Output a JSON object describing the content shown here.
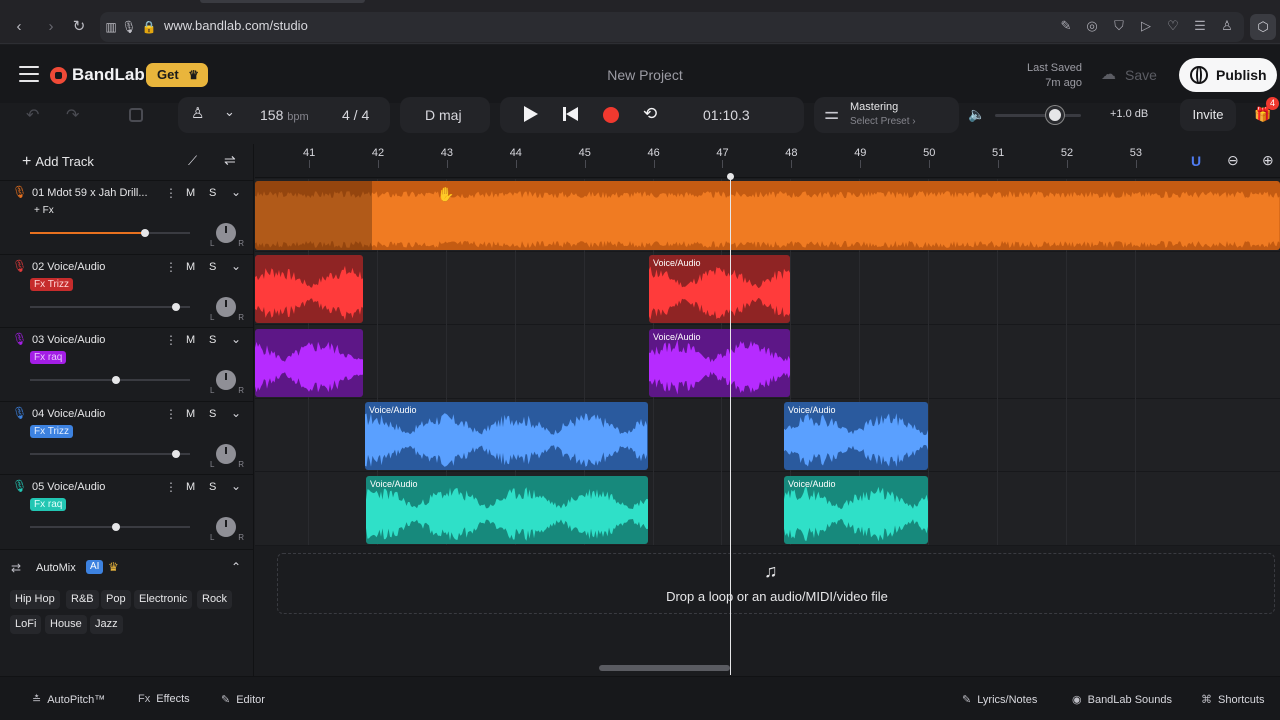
{
  "browser": {
    "url": "www.bandlab.com/studio"
  },
  "header": {
    "logo_text": "BandLab",
    "get_label": "Get",
    "project_title": "New Project",
    "last_saved_line1": "Last Saved",
    "last_saved_line2": "7m ago",
    "save_label": "Save",
    "publish_label": "Publish"
  },
  "transport": {
    "bpm_value": "158",
    "bpm_unit": "bpm",
    "time_signature": "4 / 4",
    "key": "D maj",
    "time": "01:10.3",
    "mastering_title": "Mastering",
    "mastering_sub": "Select Preset ›",
    "volume_db": "+1.0 dB",
    "volume_level": 0.7,
    "invite_label": "Invite",
    "gift_badge": "4"
  },
  "left_panel": {
    "add_track_label": "Add Track",
    "tracks": [
      {
        "number": "01",
        "name": "Mdot 59 x Jah Drill...",
        "fx": "+ Fx",
        "color": "#e8711f",
        "fx_bg": "transparent",
        "fx_color": "#e6e6e8",
        "volume": 0.72
      },
      {
        "number": "02",
        "name": "Voice/Audio",
        "fx": "Fx Trizz",
        "color": "#e23a3a",
        "fx_bg": "#c62c2c",
        "fx_color": "#ffd9d9",
        "volume": 0.91
      },
      {
        "number": "03",
        "name": "Voice/Audio",
        "fx": "Fx raq",
        "color": "#a41ee6",
        "fx_bg": "#a41ee6",
        "fx_color": "#e8c6ff",
        "volume": 0.54
      },
      {
        "number": "04",
        "name": "Voice/Audio",
        "fx": "Fx Trizz",
        "color": "#3d82e0",
        "fx_bg": "#3d82e0",
        "fx_color": "#e3eeff",
        "volume": 0.91
      },
      {
        "number": "05",
        "name": "Voice/Audio",
        "fx": "Fx raq",
        "color": "#22c6b3",
        "fx_bg": "#22c6b3",
        "fx_color": "#e0fffb",
        "volume": 0.54
      }
    ],
    "mute_label": "M",
    "solo_label": "S",
    "pan_left": "L",
    "pan_right": "R",
    "automix_title": "AutoMix",
    "ai_badge": "AI",
    "genres": [
      "Hip Hop",
      "R&B",
      "Pop",
      "Electronic",
      "Rock",
      "LoFi",
      "House",
      "Jazz"
    ]
  },
  "timeline": {
    "bars": [
      "41",
      "42",
      "43",
      "44",
      "45",
      "46",
      "47",
      "48",
      "49",
      "50",
      "51",
      "52",
      "53"
    ],
    "clip_label": "Voice/Audio",
    "drop_text": "Drop a loop or an audio/MIDI/video file"
  },
  "footer": {
    "autopitch": "AutoPitch™",
    "effects": "Effects",
    "editor": "Editor",
    "lyrics": "Lyrics/Notes",
    "sounds": "BandLab Sounds",
    "shortcuts": "Shortcuts"
  },
  "icons": {
    "back": "chevron-left-icon",
    "forward": "chevron-right-icon",
    "reload": "reload-icon",
    "reader": "reader-icon",
    "mic": "mic-icon",
    "lock": "lock-icon",
    "play": "play-icon",
    "rewind": "skip-back-icon",
    "record": "record-icon",
    "loop": "loop-icon"
  }
}
